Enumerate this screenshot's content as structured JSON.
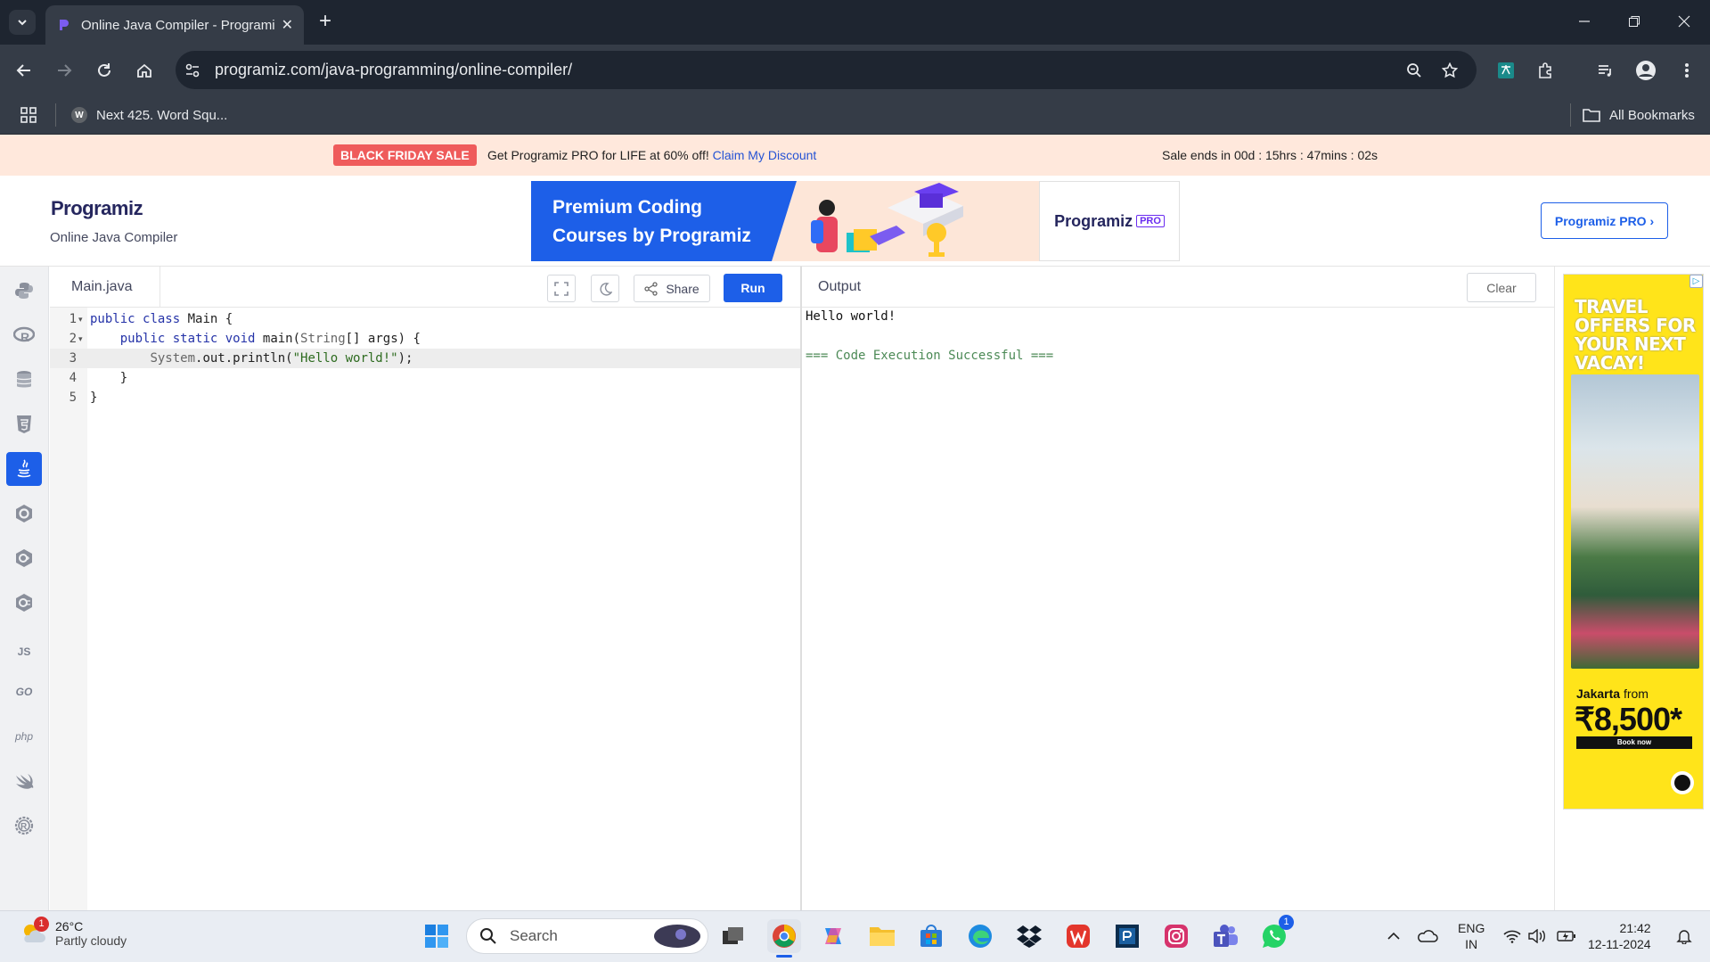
{
  "browser": {
    "tab_title": "Online Java Compiler - Programiz",
    "url": "programiz.com/java-programming/online-compiler/",
    "bookmarks": [
      {
        "label": "Next 425. Word Squ..."
      }
    ],
    "all_bookmarks_label": "All Bookmarks"
  },
  "sale_banner": {
    "badge": "BLACK FRIDAY SALE",
    "text": "Get Programiz PRO for LIFE at 60% off!",
    "link": "Claim My Discount",
    "countdown": "Sale ends in 00d : 15hrs : 47mins : 02s"
  },
  "header": {
    "logo": "Programiz",
    "subtitle": "Online Java Compiler",
    "pro_button": "Programiz PRO ›",
    "ad": {
      "headline": "Premium Coding Courses by Programiz",
      "brand": "Programiz",
      "badge": "PRO"
    }
  },
  "languages": [
    "python",
    "r",
    "sql",
    "html",
    "java",
    "c",
    "cpp",
    "csharp",
    "js",
    "go",
    "php",
    "swift",
    "rust"
  ],
  "language_labels": {
    "js": "JS",
    "go": "GO",
    "php": "php"
  },
  "active_language": "java",
  "editor": {
    "filename": "Main.java",
    "share_label": "Share",
    "run_label": "Run",
    "line_numbers": [
      "1",
      "2",
      "3",
      "4",
      "5"
    ],
    "code_lines": [
      "public class Main {",
      "    public static void main(String[] args) {",
      "        System.out.println(\"Hello world!\");",
      "    }",
      "}"
    ]
  },
  "output": {
    "title": "Output",
    "clear_label": "Clear",
    "lines": [
      "Hello world!",
      "",
      "=== Code Execution Successful ==="
    ]
  },
  "side_ad": {
    "headline_lines": [
      "TRAVEL",
      "OFFERS FOR",
      "YOUR NEXT",
      "VACAY!"
    ],
    "city": "Jakarta",
    "from": "from",
    "price": "₹8,500*",
    "cta": "Book now"
  },
  "taskbar": {
    "weather_temp": "26°C",
    "weather_desc": "Partly cloudy",
    "weather_badge": "1",
    "search_placeholder": "Search",
    "whatsapp_badge": "1",
    "lang_line1": "ENG",
    "lang_line2": "IN",
    "time": "21:42",
    "date": "12-11-2024"
  }
}
